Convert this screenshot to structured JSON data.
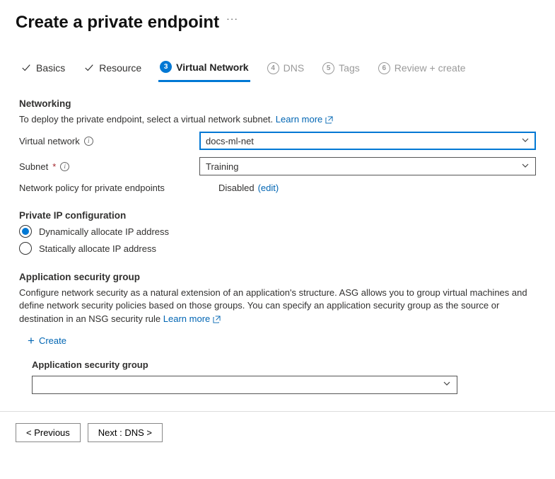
{
  "header": {
    "title": "Create a private endpoint"
  },
  "tabs": {
    "basics": "Basics",
    "resource": "Resource",
    "vnet_num": "3",
    "vnet": "Virtual Network",
    "dns_num": "4",
    "dns": "DNS",
    "tags_num": "5",
    "tags": "Tags",
    "review_num": "6",
    "review": "Review + create"
  },
  "networking": {
    "title": "Networking",
    "desc": "To deploy the private endpoint, select a virtual network subnet.",
    "learn": "Learn more",
    "vnet_label": "Virtual network",
    "vnet_value": "docs-ml-net",
    "subnet_label": "Subnet",
    "subnet_value": "Training",
    "policy_label": "Network policy for private endpoints",
    "policy_value": "Disabled",
    "policy_edit": "(edit)"
  },
  "ipconfig": {
    "title": "Private IP configuration",
    "dynamic": "Dynamically allocate IP address",
    "static": "Statically allocate IP address"
  },
  "asg": {
    "title": "Application security group",
    "desc": "Configure network security as a natural extension of an application's structure. ASG allows you to group virtual machines and define network security policies based on those groups. You can specify an application security group as the source or destination in an NSG security rule",
    "learn": "Learn more",
    "create": "Create",
    "col": "Application security group"
  },
  "footer": {
    "prev": "< Previous",
    "next": "Next : DNS >"
  }
}
